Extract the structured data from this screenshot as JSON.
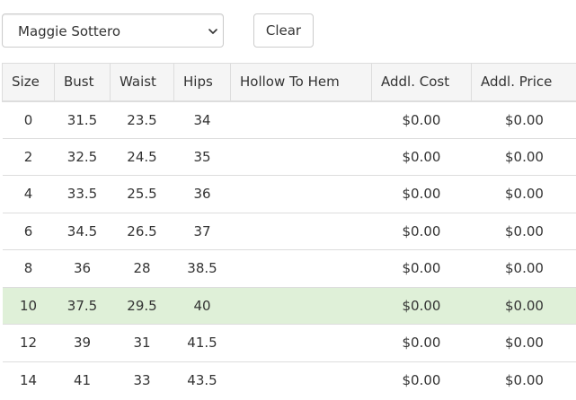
{
  "toolbar": {
    "designer_select": {
      "selected": "Maggie Sottero",
      "icon": "chevron-down-icon"
    },
    "clear_label": "Clear"
  },
  "table": {
    "headers": [
      "Size",
      "Bust",
      "Waist",
      "Hips",
      "Hollow To Hem",
      "Addl. Cost",
      "Addl. Price"
    ],
    "rows": [
      {
        "size": "0",
        "bust": "31.5",
        "waist": "23.5",
        "hips": "34",
        "hollow_to_hem": "",
        "addl_cost": "$0.00",
        "addl_price": "$0.00",
        "highlighted": false
      },
      {
        "size": "2",
        "bust": "32.5",
        "waist": "24.5",
        "hips": "35",
        "hollow_to_hem": "",
        "addl_cost": "$0.00",
        "addl_price": "$0.00",
        "highlighted": false
      },
      {
        "size": "4",
        "bust": "33.5",
        "waist": "25.5",
        "hips": "36",
        "hollow_to_hem": "",
        "addl_cost": "$0.00",
        "addl_price": "$0.00",
        "highlighted": false
      },
      {
        "size": "6",
        "bust": "34.5",
        "waist": "26.5",
        "hips": "37",
        "hollow_to_hem": "",
        "addl_cost": "$0.00",
        "addl_price": "$0.00",
        "highlighted": false
      },
      {
        "size": "8",
        "bust": "36",
        "waist": "28",
        "hips": "38.5",
        "hollow_to_hem": "",
        "addl_cost": "$0.00",
        "addl_price": "$0.00",
        "highlighted": false
      },
      {
        "size": "10",
        "bust": "37.5",
        "waist": "29.5",
        "hips": "40",
        "hollow_to_hem": "",
        "addl_cost": "$0.00",
        "addl_price": "$0.00",
        "highlighted": true
      },
      {
        "size": "12",
        "bust": "39",
        "waist": "31",
        "hips": "41.5",
        "hollow_to_hem": "",
        "addl_cost": "$0.00",
        "addl_price": "$0.00",
        "highlighted": false
      },
      {
        "size": "14",
        "bust": "41",
        "waist": "33",
        "hips": "43.5",
        "hollow_to_hem": "",
        "addl_cost": "$0.00",
        "addl_price": "$0.00",
        "highlighted": false
      }
    ]
  },
  "colors": {
    "header_bg": "#f5f5f5",
    "highlight_row_bg": "#dff0d8",
    "border": "#dddddd",
    "text": "#333333"
  }
}
